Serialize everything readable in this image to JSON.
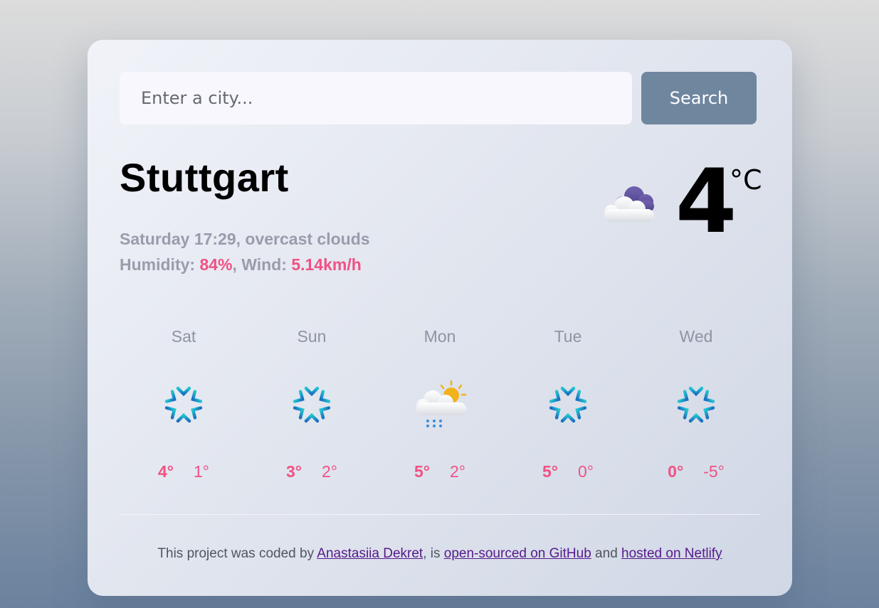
{
  "search": {
    "placeholder": "Enter a city...",
    "button_label": "Search"
  },
  "current": {
    "city": "Stuttgart",
    "datetime": "Saturday 17:29",
    "description": "overcast clouds",
    "humidity_label": "Humidity: ",
    "humidity_value": "84%",
    "wind_label": "Wind: ",
    "wind_value": "5.14km/h",
    "temperature": "4",
    "unit": "°C",
    "icon": "overcast-clouds-icon"
  },
  "forecast": [
    {
      "day": "Sat",
      "max": "4°",
      "min": "1°",
      "icon": "snowflake-icon"
    },
    {
      "day": "Sun",
      "max": "3°",
      "min": "2°",
      "icon": "snowflake-icon"
    },
    {
      "day": "Mon",
      "max": "5°",
      "min": "2°",
      "icon": "sun-cloud-rain-icon"
    },
    {
      "day": "Tue",
      "max": "5°",
      "min": "0°",
      "icon": "snowflake-icon"
    },
    {
      "day": "Wed",
      "max": "0°",
      "min": "-5°",
      "icon": "snowflake-icon"
    }
  ],
  "footer": {
    "prefix": "This project was coded by ",
    "author_link": "Anastasiia Dekret",
    "middle": ", is ",
    "github_link": "open-sourced on GitHub",
    "and": " and ",
    "netlify_link": "hosted on Netlify"
  },
  "colors": {
    "accent": "#ef5284",
    "button": "#6f869f",
    "muted_text": "#9a9cac",
    "link": "#551a8b"
  }
}
